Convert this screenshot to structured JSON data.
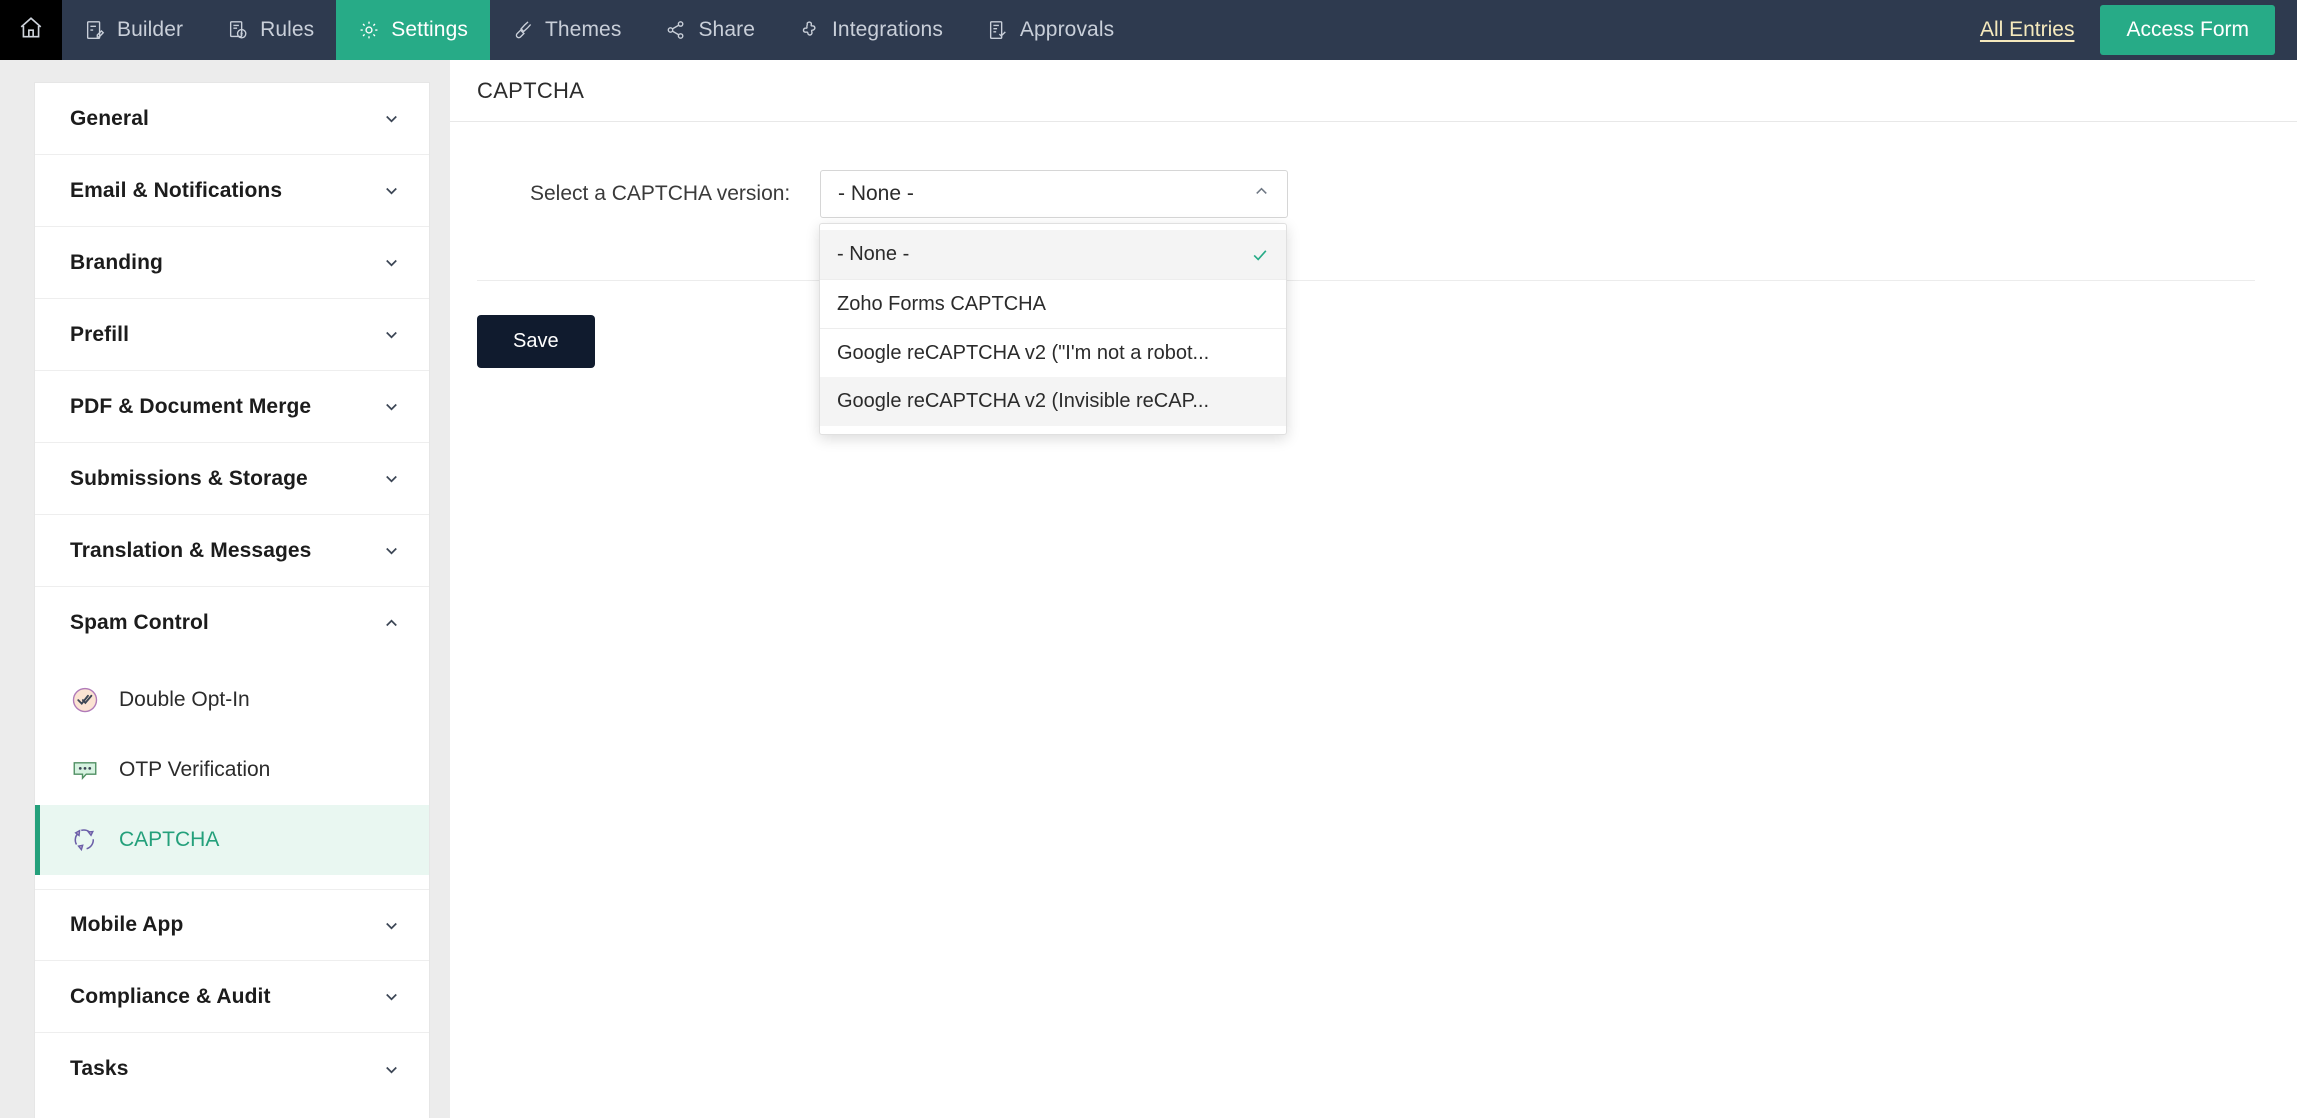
{
  "topnav": {
    "home_icon": "home-icon",
    "items": [
      {
        "label": "Builder",
        "icon": "builder-icon",
        "active": false
      },
      {
        "label": "Rules",
        "icon": "rules-icon",
        "active": false
      },
      {
        "label": "Settings",
        "icon": "gear-icon",
        "active": true
      },
      {
        "label": "Themes",
        "icon": "brush-icon",
        "active": false
      },
      {
        "label": "Share",
        "icon": "share-icon",
        "active": false
      },
      {
        "label": "Integrations",
        "icon": "puzzle-icon",
        "active": false
      },
      {
        "label": "Approvals",
        "icon": "approvals-icon",
        "active": false
      }
    ],
    "all_entries": "All Entries",
    "access_form": "Access Form"
  },
  "colors": {
    "navbar_bg": "#2e3a4f",
    "accent_teal": "#27ab87",
    "all_entries_text": "#f5e9bd",
    "save_button_bg": "#101b2e",
    "selected_item_bg": "#e9f7f1",
    "selected_item_text": "#24a07b"
  },
  "sidebar": {
    "sections": [
      {
        "label": "General",
        "expanded": false
      },
      {
        "label": "Email & Notifications",
        "expanded": false
      },
      {
        "label": "Branding",
        "expanded": false
      },
      {
        "label": "Prefill",
        "expanded": false
      },
      {
        "label": "PDF & Document Merge",
        "expanded": false
      },
      {
        "label": "Submissions & Storage",
        "expanded": false
      },
      {
        "label": "Translation & Messages",
        "expanded": false
      },
      {
        "label": "Spam Control",
        "expanded": true
      },
      {
        "label": "Mobile App",
        "expanded": false
      },
      {
        "label": "Compliance & Audit",
        "expanded": false
      },
      {
        "label": "Tasks",
        "expanded": false
      }
    ],
    "spam_control_items": [
      {
        "label": "Double Opt-In",
        "icon": "double-check-circle-icon",
        "selected": false
      },
      {
        "label": "OTP Verification",
        "icon": "otp-chat-icon",
        "selected": false
      },
      {
        "label": "CAPTCHA",
        "icon": "captcha-icon",
        "selected": true
      }
    ]
  },
  "main": {
    "page_title": "CAPTCHA",
    "field_label": "Select a CAPTCHA version:",
    "select": {
      "value": "- None -",
      "expanded": true,
      "options": [
        {
          "label": "- None -",
          "selected": true
        },
        {
          "label": "Zoho Forms CAPTCHA",
          "selected": false
        },
        {
          "label": "Google reCAPTCHA v2 (\"I'm not a robot...",
          "selected": false
        },
        {
          "label": "Google reCAPTCHA v2 (Invisible reCAP...",
          "selected": false
        }
      ]
    },
    "save_label": "Save"
  }
}
